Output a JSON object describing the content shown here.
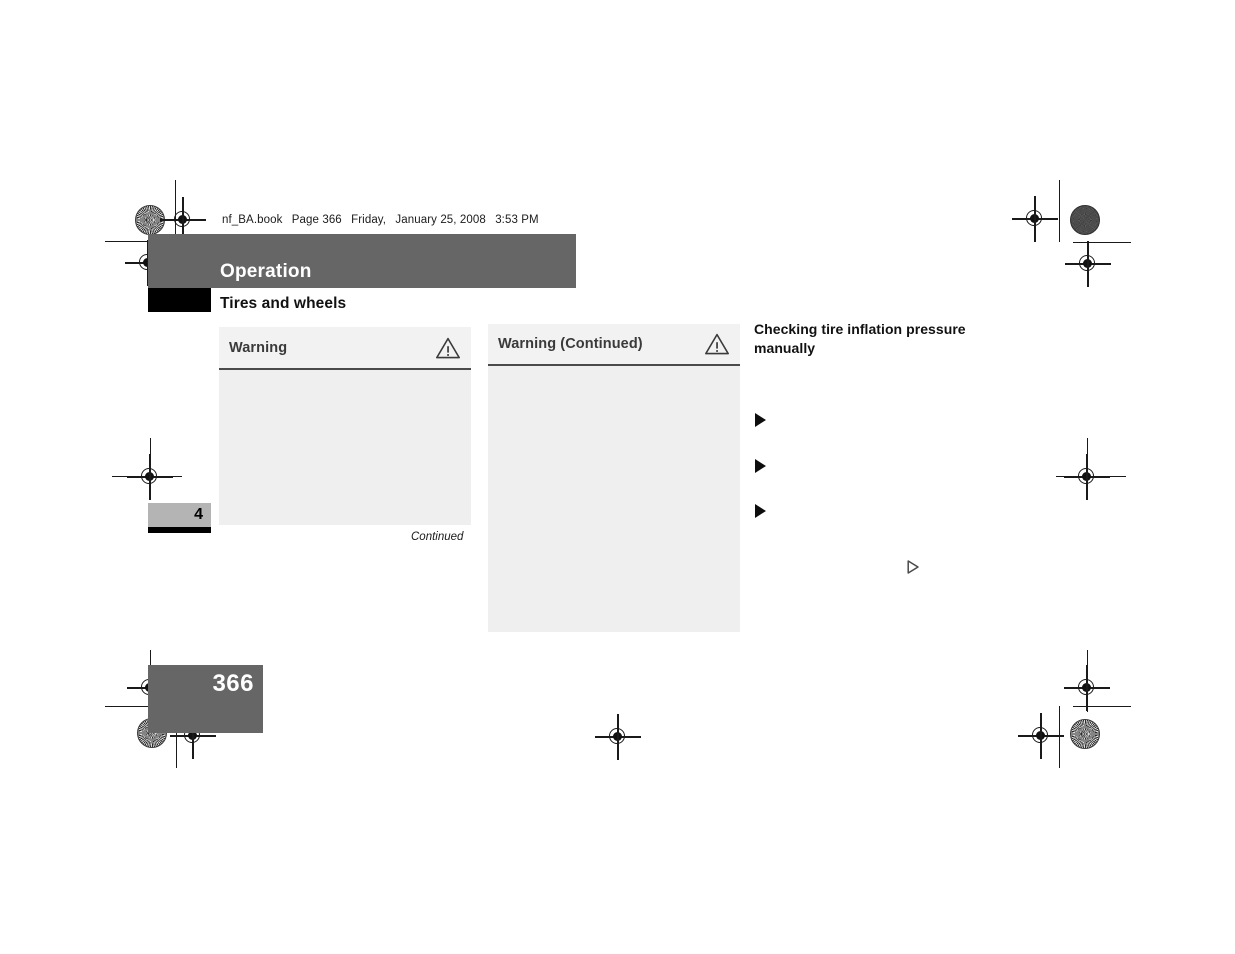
{
  "document": {
    "slug": {
      "file_name": "nf_BA.book",
      "page_label": "Page 366",
      "weekday": "Friday,",
      "date": "January 25, 2008",
      "time": "3:53 PM"
    },
    "header": {
      "running_title": "Operation",
      "section_title": "Tires and wheels"
    },
    "chapter_tab": {
      "number": "4"
    },
    "page_number": "366",
    "colors": {
      "header_bar": "#666666",
      "section_tab": "#000000",
      "chapter_tab": "#b4b4b4",
      "page_number_block": "#666666",
      "warning_body": "#efefef",
      "warning_head": "#f2f2f2",
      "warning_rule": "#4a4a4a",
      "text": "#111111",
      "white": "#ffffff"
    }
  },
  "warnings": [
    {
      "title": "Warning",
      "icon": "warning-triangle-icon",
      "body_text": "",
      "footer_note": "Continued"
    },
    {
      "title": "Warning (Continued)",
      "icon": "warning-triangle-icon",
      "body_text": "",
      "footer_note": ""
    }
  ],
  "right_column": {
    "heading": "Checking tire inflation pressure manually",
    "bullets": [
      {
        "marker": "filled-triangle-bullet",
        "text": ""
      },
      {
        "marker": "filled-triangle-bullet",
        "text": ""
      },
      {
        "marker": "filled-triangle-bullet",
        "text": ""
      }
    ],
    "continuation_marker": "hollow-triangle-icon"
  },
  "prepress_marks": {
    "registration_targets": 10,
    "rosette_targets": 3,
    "density_dots": 2,
    "description": "printer registration crosshairs, crop lines and density patches"
  }
}
